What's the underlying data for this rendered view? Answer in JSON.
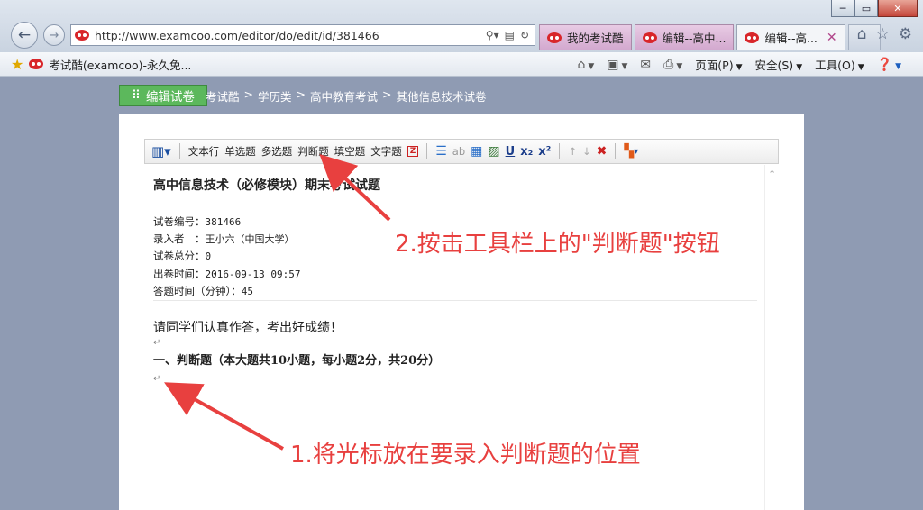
{
  "window": {
    "minimize": "─",
    "restore": "▭",
    "close": "✕"
  },
  "address": {
    "url": "http://www.examcoo.com/editor/do/edit/id/381466"
  },
  "tabs": [
    {
      "label": "我的考试酷",
      "active": false
    },
    {
      "label": "编辑--高中...",
      "active": false
    },
    {
      "label": "编辑--高...",
      "active": true
    }
  ],
  "favorites": {
    "label": "考试酷(examcoo)-永久免..."
  },
  "command_bar": {
    "page": "页面(P)",
    "safety": "安全(S)",
    "tools": "工具(O)"
  },
  "page": {
    "edit_button": "编辑试卷",
    "breadcrumb": [
      "考试酷",
      ">",
      "学历类",
      ">",
      "高中教育考试",
      ">",
      "其他信息技术试卷"
    ]
  },
  "editor_toolbar": {
    "text_line": "文本行",
    "single": "单选题",
    "multi": "多选题",
    "judge": "判断题",
    "fill": "填空题",
    "text_q": "文字题",
    "z": "Z",
    "u": "U",
    "sub": "x₂",
    "sup": "x²"
  },
  "document": {
    "title": "高中信息技术（必修模块）期末考试试题",
    "meta": [
      {
        "label": "试卷编号：",
        "value": "381466"
      },
      {
        "label": "录入者　：",
        "value": "王小六（中国大学）"
      },
      {
        "label": "试卷总分：",
        "value": "0"
      },
      {
        "label": "出卷时间：",
        "value": "2016-09-13 09:57"
      },
      {
        "label": "答题时间（分钟）：",
        "value": "45"
      }
    ],
    "intro": "请同学们认真作答，考出好成绩！",
    "para_mark": "↵",
    "section": "一、判断题（本大题共10小题，每小题2分，共20分）"
  },
  "annotations": {
    "step2": "2.按击工具栏上的\"判断题\"按钮",
    "step1": "1.将光标放在要录入判断题的位置"
  },
  "colors": {
    "annotation": "#e8403f",
    "edit_button": "#5cb85c",
    "page_bg": "#8f9bb3"
  }
}
